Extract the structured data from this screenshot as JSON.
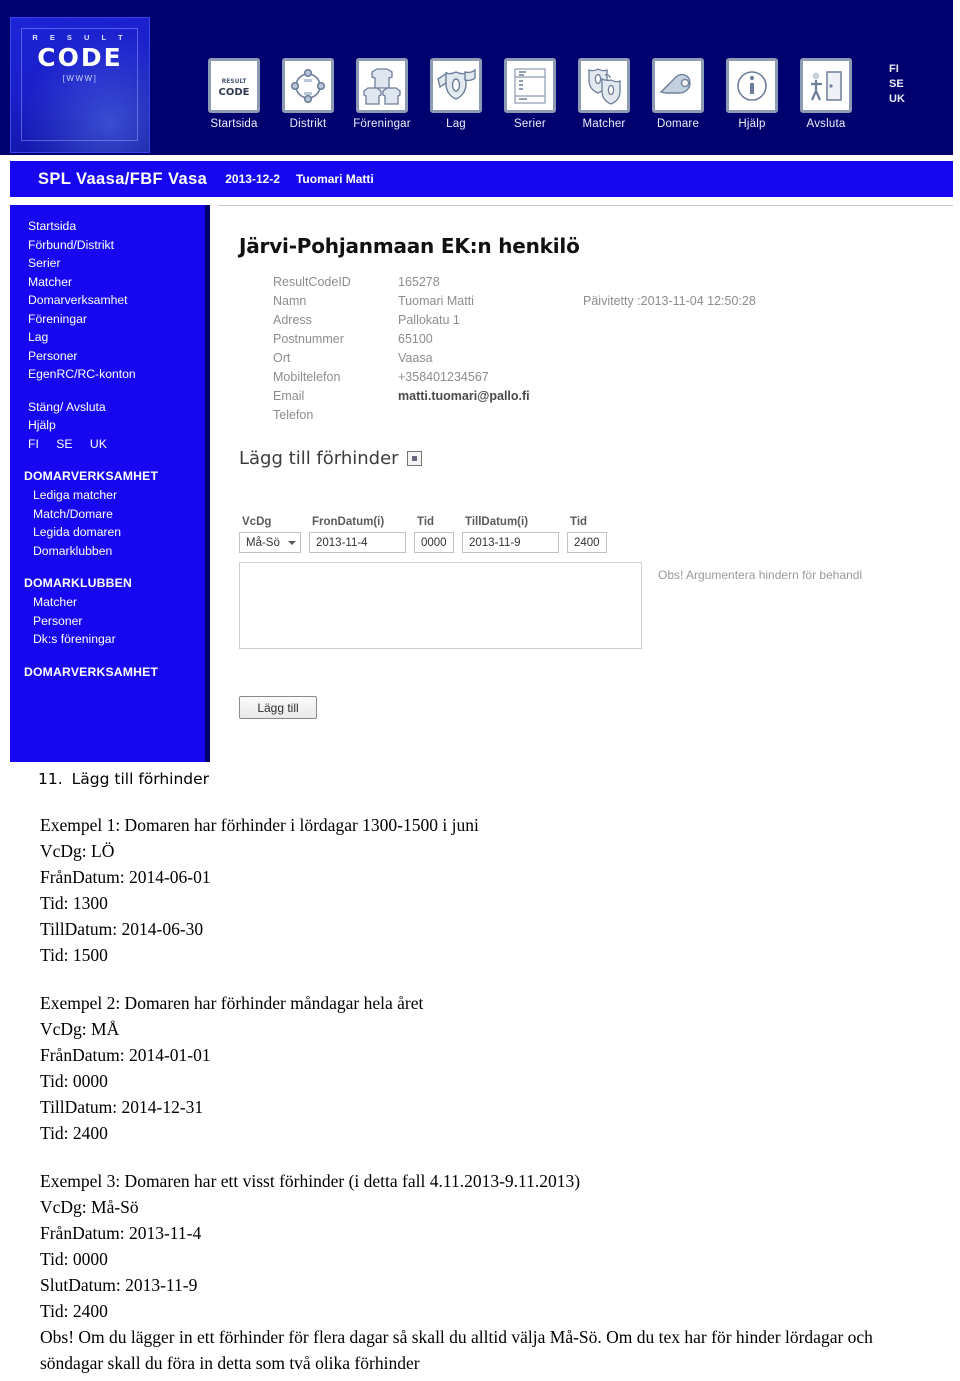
{
  "app": {
    "logo": {
      "result": "R E S U L T",
      "code": "CODE",
      "www": "[WWW]"
    },
    "toolbar": [
      {
        "label": "Startsida",
        "icon": "resultcode-logo-icon"
      },
      {
        "label": "Distrikt",
        "icon": "people-circle-icon"
      },
      {
        "label": "Föreningar",
        "icon": "jerseys-icon"
      },
      {
        "label": "Lag",
        "icon": "shield-flag-icon"
      },
      {
        "label": "Serier",
        "icon": "table-list-icon"
      },
      {
        "label": "Matcher",
        "icon": "two-shields-icon"
      },
      {
        "label": "Domare",
        "icon": "whistle-icon"
      },
      {
        "label": "Hjälp",
        "icon": "info-circle-icon"
      },
      {
        "label": "Avsluta",
        "icon": "exit-door-icon"
      }
    ],
    "languages": [
      "FI",
      "SE",
      "UK"
    ]
  },
  "context_bar": {
    "organization": "SPL Vaasa/FBF Vasa",
    "date": "2013-12-2",
    "user": "Tuomari Matti"
  },
  "sidebar": {
    "main_links": [
      "Startsida",
      "Förbund/Distrikt",
      "Serier",
      "Matcher",
      "Domarverksamhet",
      "Föreningar",
      "Lag",
      "Personer",
      "EgenRC/RC-konton"
    ],
    "utility_links": [
      "Stäng/ Avsluta",
      "Hjälp"
    ],
    "languages": [
      "FI",
      "SE",
      "UK"
    ],
    "section_1": {
      "heading": "DOMARVERKSAMHET",
      "items": [
        "Lediga matcher",
        "Match/Domare",
        "Legida domaren",
        "Domarklubben"
      ]
    },
    "section_2": {
      "heading": "DOMARKLUBBEN",
      "items": [
        "Matcher",
        "Personer",
        "Dk:s föreningar"
      ]
    },
    "section_3": {
      "heading": "DOMARVERKSAMHET"
    }
  },
  "content": {
    "title": "Järvi-Pohjanmaan EK:n henkilö",
    "details": [
      {
        "label": "ResultCodeID",
        "value": "165278",
        "extra": ""
      },
      {
        "label": "Namn",
        "value": "Tuomari Matti",
        "extra": "Päivitetty :2013-11-04 12:50:28"
      },
      {
        "label": "Adress",
        "value": "Pallokatu 1",
        "extra": ""
      },
      {
        "label": "Postnummer",
        "value": "65100",
        "extra": ""
      },
      {
        "label": "Ort",
        "value": "Vaasa",
        "extra": ""
      },
      {
        "label": "Mobiltelefon",
        "value": "+358401234567",
        "extra": ""
      },
      {
        "label": "Email",
        "value": "matti.tuomari@pallo.fi",
        "extra": ""
      },
      {
        "label": "Telefon",
        "value": "",
        "extra": ""
      }
    ],
    "form": {
      "heading": "Lägg till förhinder",
      "expand_icon": "expand-square-icon",
      "labels": {
        "vcdg": "VcDg",
        "from_date": "FronDatum(i)",
        "from_time": "Tid",
        "to_date": "TillDatum(i)",
        "to_time": "Tid"
      },
      "values": {
        "vcdg": "Må-Sö",
        "from_date": "2013-11-4",
        "from_time": "0000",
        "to_date": "2013-11-9",
        "to_time": "2400"
      },
      "note_value": "",
      "obs_hint": "Obs! Argumentera hindern för behandl",
      "submit_label": "Lägg till"
    }
  },
  "document": {
    "heading_number": "11.",
    "heading_text": "Lägg till förhinder",
    "blocks": [
      {
        "lines": [
          "Exempel 1: Domaren har förhinder i lördagar 1300-1500 i juni",
          "VcDg: LÖ",
          "FrånDatum: 2014-06-01",
          "Tid: 1300",
          "TillDatum: 2014-06-30",
          "Tid: 1500"
        ]
      },
      {
        "lines": [
          "Exempel 2: Domaren har förhinder måndagar hela året",
          "VcDg: MÅ",
          "FrånDatum: 2014-01-01",
          "Tid: 0000",
          "TillDatum: 2014-12-31",
          "Tid: 2400"
        ]
      },
      {
        "lines": [
          "Exempel 3: Domaren har ett visst förhinder (i detta fall 4.11.2013-9.11.2013)",
          "VcDg: Må-Sö",
          "FrånDatum: 2013-11-4",
          "Tid: 0000",
          "SlutDatum: 2013-11-9",
          "Tid: 2400"
        ],
        "paragraph": "Obs! Om du lägger in ett förhinder för flera dagar så skall du alltid välja Må-Sö. Om du tex har för hinder lördagar och söndagar skall du föra in detta som två olika förhinder"
      }
    ]
  }
}
